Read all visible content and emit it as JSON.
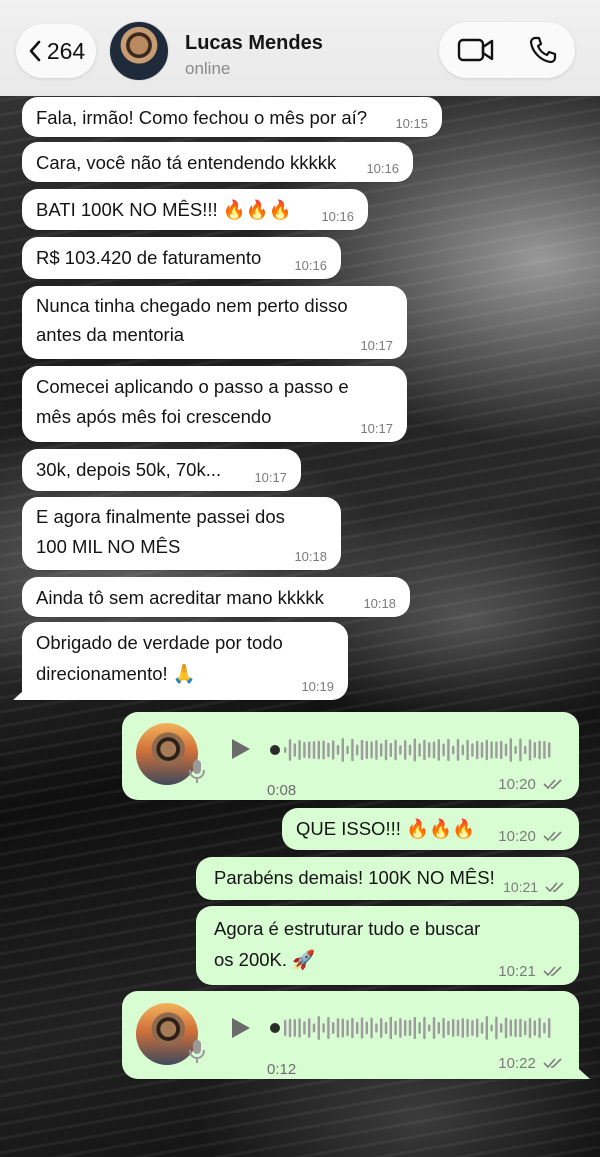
{
  "header": {
    "back_count": "264",
    "contact_name": "Lucas Mendes",
    "contact_status": "online"
  },
  "icons": {
    "back": "chevron-left-icon",
    "video": "video-camera-icon",
    "phone": "phone-icon",
    "play": "play-icon",
    "mic": "microphone-icon",
    "read": "double-check-icon"
  },
  "colors": {
    "incoming_bubble": "#ffffff",
    "outgoing_bubble": "#d9fdd3",
    "read_checks": "#7b7b7b"
  },
  "messages": [
    {
      "lines": [
        "Fala, irmão! Como fechou o mês por aí?"
      ],
      "time": "10:15"
    },
    {
      "lines": [
        "Cara, você não tá entendendo kkkkk"
      ],
      "time": "10:16"
    },
    {
      "lines": [
        "BATI 100K NO MÊS!!! 🔥🔥🔥"
      ],
      "time": "10:16"
    },
    {
      "lines": [
        "R$ 103.420 de faturamento"
      ],
      "time": "10:16"
    },
    {
      "lines": [
        "Nunca tinha chegado nem perto disso",
        "antes da mentoria"
      ],
      "time": "10:17"
    },
    {
      "lines": [
        "Comecei aplicando o passo a passo e",
        "mês após mês foi crescendo"
      ],
      "time": "10:17"
    },
    {
      "lines": [
        "30k, depois 50k, 70k..."
      ],
      "time": "10:17"
    },
    {
      "lines": [
        "E agora finalmente passei dos",
        "100 MIL NO MÊS"
      ],
      "time": "10:18"
    },
    {
      "lines": [
        "Ainda tô sem acreditar mano kkkkk"
      ],
      "time": "10:18"
    },
    {
      "lines": [
        "Obrigado de verdade por todo",
        "direcionamento! 🙏"
      ],
      "time": "10:19"
    },
    {
      "audio": true,
      "duration": "0:08",
      "time": "10:20"
    },
    {
      "lines": [
        "QUE ISSO!!! 🔥🔥🔥"
      ],
      "time": "10:20"
    },
    {
      "lines": [
        "Parabéns demais! 100K NO MÊS!"
      ],
      "time": "10:21"
    },
    {
      "lines": [
        "Agora é estruturar tudo e buscar",
        "os 200K. 🚀"
      ],
      "time": "10:21"
    },
    {
      "audio": true,
      "duration": "0:12",
      "time": "10:22"
    }
  ]
}
